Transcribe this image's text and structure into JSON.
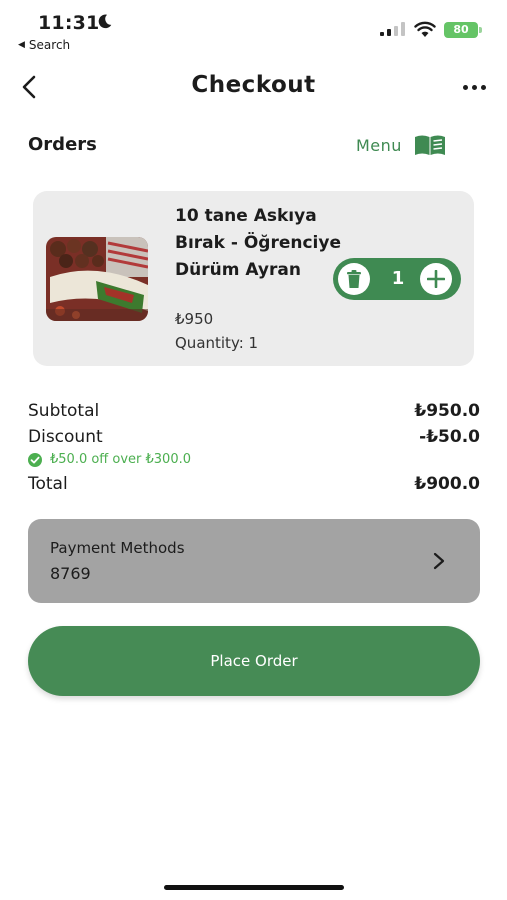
{
  "status_bar": {
    "time": "11:31",
    "back_app": "Search",
    "battery": "80"
  },
  "header": {
    "title": "Checkout"
  },
  "orders": {
    "heading": "Orders",
    "menu_label": "Menu"
  },
  "order_item": {
    "name": "10 tane Askıya Bırak - Öğrenciye Dürüm Ayran",
    "price": "₺950",
    "quantity_label": "Quantity: 1",
    "stepper_qty": "1"
  },
  "summary": {
    "subtotal_label": "Subtotal",
    "subtotal_value": "₺950.0",
    "discount_label": "Discount",
    "discount_value": "-₺50.0",
    "discount_note": "₺50.0 off over ₺300.0",
    "total_label": "Total",
    "total_value": "₺900.0"
  },
  "payment": {
    "label": "Payment Methods",
    "value": "8769"
  },
  "actions": {
    "place_order": "Place Order"
  },
  "colors": {
    "brand_green": "#468b55",
    "success_green": "#4caf50"
  }
}
